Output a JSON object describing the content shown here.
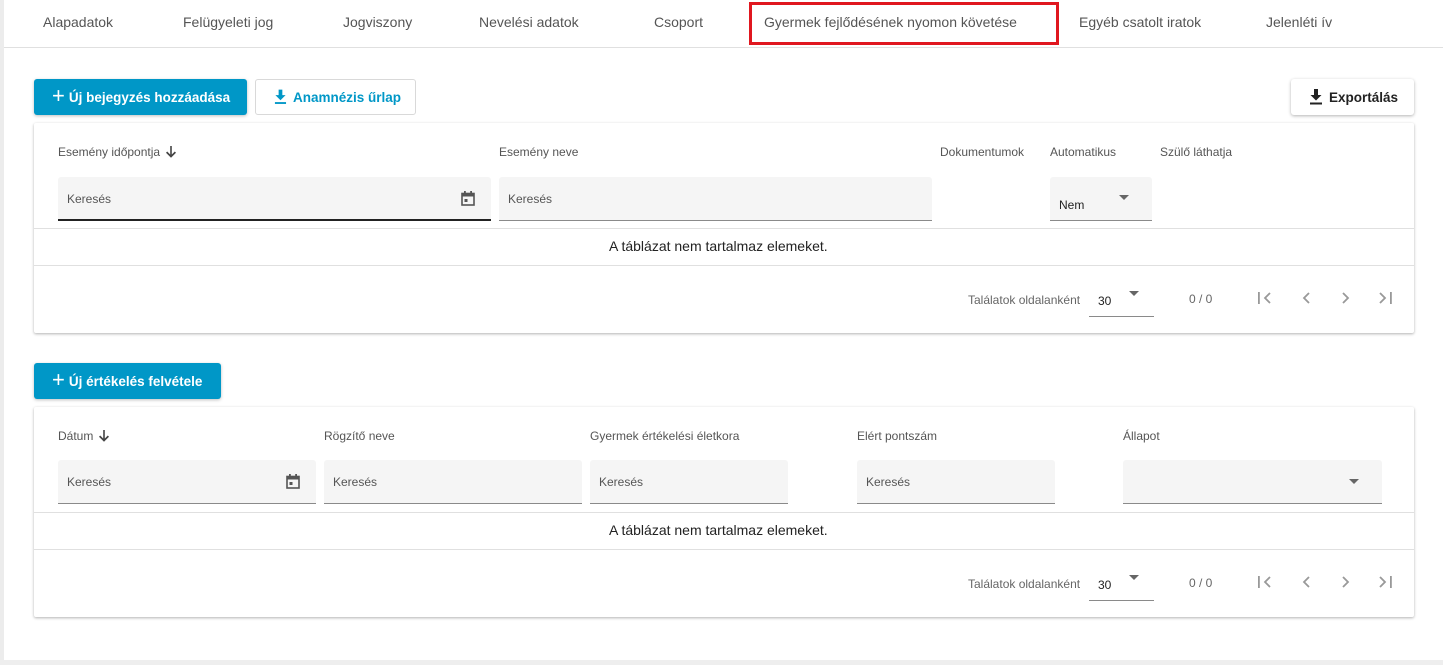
{
  "tabs": [
    {
      "label": "Alapadatok"
    },
    {
      "label": "Felügyeleti jog"
    },
    {
      "label": "Jogviszony"
    },
    {
      "label": "Nevelési adatok"
    },
    {
      "label": "Csoport"
    },
    {
      "label": "Gyermek fejlődésének nyomon követése",
      "active": true
    },
    {
      "label": "Egyéb csatolt iratok"
    },
    {
      "label": "Jelenléti ív"
    }
  ],
  "colors": {
    "primary": "#0097c7",
    "highlight": "#e0171f"
  },
  "section1": {
    "add_button": "Új bejegyzés hozzáadása",
    "anamnesis_button": "Anamnézis űrlap",
    "export_button": "Exportálás",
    "columns": {
      "event_time": "Esemény időpontja",
      "event_name": "Esemény neve",
      "documents": "Dokumentumok",
      "automatic": "Automatikus",
      "parent_visible": "Szülő láthatja"
    },
    "filters": {
      "event_time_placeholder": "Keresés",
      "event_name_placeholder": "Keresés",
      "automatic_value": "Nem"
    },
    "empty_message": "A táblázat nem tartalmaz elemeket.",
    "pager": {
      "label": "Találatok oldalanként",
      "page_size": "30",
      "range": "0 / 0"
    }
  },
  "section2": {
    "add_button": "Új értékelés felvétele",
    "columns": {
      "date": "Dátum",
      "recorder": "Rögzítő neve",
      "child_age": "Gyermek értékelési életkora",
      "score": "Elért pontszám",
      "status": "Állapot"
    },
    "filters": {
      "date_placeholder": "Keresés",
      "recorder_placeholder": "Keresés",
      "child_age_placeholder": "Keresés",
      "score_placeholder": "Keresés",
      "status_value": ""
    },
    "empty_message": "A táblázat nem tartalmaz elemeket.",
    "pager": {
      "label": "Találatok oldalanként",
      "page_size": "30",
      "range": "0 / 0"
    }
  }
}
